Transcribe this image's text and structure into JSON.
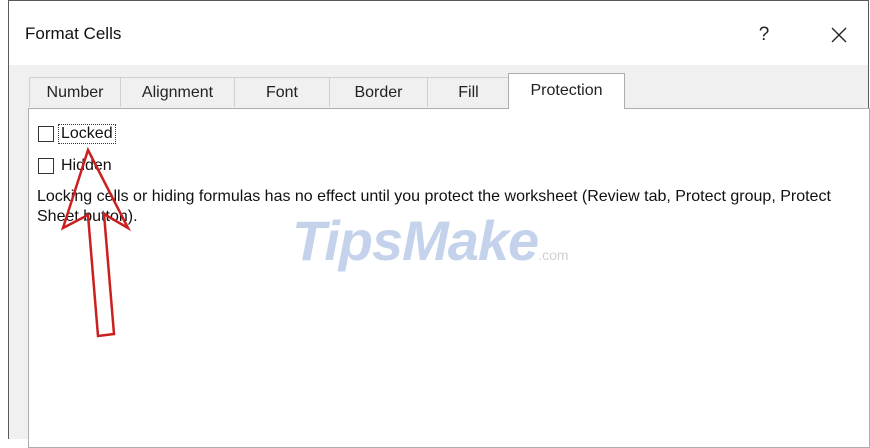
{
  "dialog": {
    "title": "Format Cells",
    "help_label": "?"
  },
  "tabs": [
    {
      "label": "Number"
    },
    {
      "label": "Alignment"
    },
    {
      "label": "Font"
    },
    {
      "label": "Border"
    },
    {
      "label": "Fill"
    },
    {
      "label": "Protection",
      "active": true
    }
  ],
  "protection": {
    "locked": {
      "label": "Locked",
      "checked": false
    },
    "hidden": {
      "label": "Hidden",
      "checked": false
    },
    "info_text": "Locking cells or hiding formulas has no effect until you protect the worksheet (Review tab, Protect group, Protect Sheet button)."
  },
  "overlay": {
    "watermark_brand": "TipsMake",
    "watermark_suffix": ".com",
    "arrow_color": "#cc1f1f"
  }
}
